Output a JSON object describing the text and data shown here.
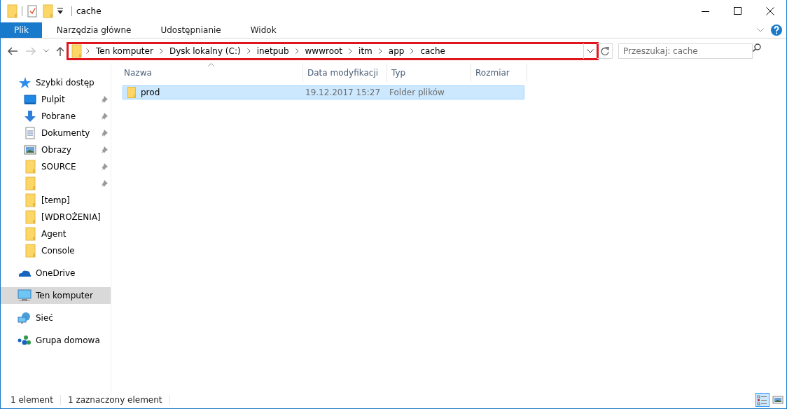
{
  "window": {
    "title": "cache"
  },
  "ribbon_tabs": [
    {
      "label": "Plik",
      "selected": true
    },
    {
      "label": "Narzędzia główne",
      "selected": false
    },
    {
      "label": "Udostępnianie",
      "selected": false
    },
    {
      "label": "Widok",
      "selected": false
    }
  ],
  "address": {
    "highlighted": true,
    "breadcrumbs": [
      "Ten komputer",
      "Dysk lokalny (C:)",
      "inetpub",
      "wwwroot",
      "itm",
      "app",
      "cache"
    ]
  },
  "search": {
    "placeholder": "Przeszukaj: cache"
  },
  "sidebar": {
    "items": [
      {
        "label": "Szybki dostęp",
        "kind": "quick-access",
        "selected": false,
        "children": [
          {
            "label": "Pulpit",
            "kind": "desktop",
            "pinned": true,
            "selected": false
          },
          {
            "label": "Pobrane",
            "kind": "downloads",
            "pinned": true,
            "selected": false
          },
          {
            "label": "Dokumenty",
            "kind": "documents",
            "pinned": true,
            "selected": false
          },
          {
            "label": "Obrazy",
            "kind": "pictures",
            "pinned": true,
            "selected": false
          },
          {
            "label": "SOURCE",
            "kind": "folder",
            "pinned": true,
            "selected": false
          },
          {
            "kind": "folder",
            "pinned": true,
            "selected": false
          },
          {
            "label": "[temp]",
            "kind": "folder",
            "pinned": false,
            "selected": false
          },
          {
            "label": "[WDROŻENIA]",
            "kind": "folder",
            "pinned": false,
            "selected": false
          },
          {
            "label": "Agent",
            "kind": "folder",
            "pinned": false,
            "selected": false
          },
          {
            "label": "Console",
            "kind": "folder",
            "pinned": false,
            "selected": false
          }
        ]
      },
      {
        "label": "OneDrive",
        "kind": "onedrive",
        "selected": false
      },
      {
        "label": "Ten komputer",
        "kind": "computer",
        "selected": true
      },
      {
        "label": "Sieć",
        "kind": "network",
        "selected": false
      },
      {
        "label": "Grupa domowa",
        "kind": "homegroup",
        "selected": false
      }
    ]
  },
  "table": {
    "columns": [
      {
        "label": "Nazwa",
        "sorted": true
      },
      {
        "label": "Data modyfikacji",
        "sorted": false
      },
      {
        "label": "Typ",
        "sorted": false
      },
      {
        "label": "Rozmiar",
        "sorted": false
      }
    ],
    "rows": [
      {
        "name": "prod",
        "modified": "19.12.2017 15:27",
        "type": "Folder plików",
        "selected": true
      }
    ]
  },
  "status_bar": {
    "items": [
      "1 element",
      "1 zaznaczony element"
    ],
    "views": [
      {
        "kind": "details",
        "selected": true
      },
      {
        "kind": "large-icons",
        "selected": false
      }
    ]
  }
}
